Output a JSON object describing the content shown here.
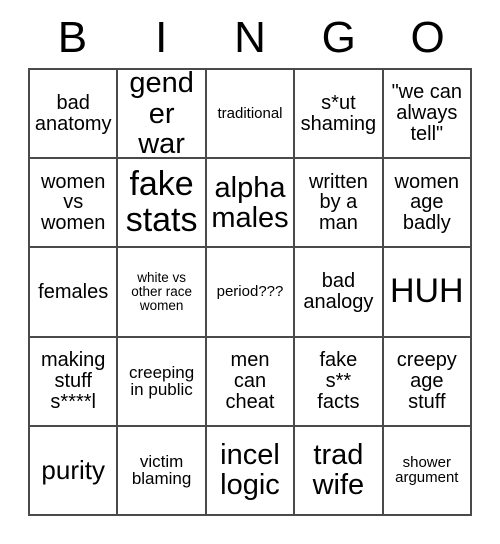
{
  "header": {
    "letters": [
      "B",
      "I",
      "N",
      "G",
      "O"
    ]
  },
  "grid": {
    "rows": 5,
    "columns": 5,
    "border_color": "#4a4a4a",
    "cell_background": "#ffffff",
    "text_color": "#000000",
    "cells": [
      {
        "text": "bad\nanatomy",
        "size": "md"
      },
      {
        "text": "gender\nwar",
        "size": "xl"
      },
      {
        "text": "traditional",
        "size": "xs"
      },
      {
        "text": "s*ut\nshaming",
        "size": "md"
      },
      {
        "text": "\"we can\nalways\ntell\"",
        "size": "md"
      },
      {
        "text": "women\nvs\nwomen",
        "size": "md"
      },
      {
        "text": "fake\nstats",
        "size": "xxl"
      },
      {
        "text": "alpha\nmales",
        "size": "xl"
      },
      {
        "text": "written\nby a\nman",
        "size": "md"
      },
      {
        "text": "women\nage\nbadly",
        "size": "md"
      },
      {
        "text": "females",
        "size": "md"
      },
      {
        "text": "white vs\nother race\nwomen",
        "size": "xxs"
      },
      {
        "text": "period???",
        "size": "xs"
      },
      {
        "text": "bad\nanalogy",
        "size": "md"
      },
      {
        "text": "HUH",
        "size": "xxl"
      },
      {
        "text": "making\nstuff\ns****l",
        "size": "md"
      },
      {
        "text": "creeping\nin public",
        "size": "sm"
      },
      {
        "text": "men\ncan\ncheat",
        "size": "md"
      },
      {
        "text": "fake\ns**\nfacts",
        "size": "md"
      },
      {
        "text": "creepy\nage\nstuff",
        "size": "md"
      },
      {
        "text": "purity",
        "size": "lg"
      },
      {
        "text": "victim\nblaming",
        "size": "sm"
      },
      {
        "text": "incel\nlogic",
        "size": "xl"
      },
      {
        "text": "trad\nwife",
        "size": "xl"
      },
      {
        "text": "shower\nargument",
        "size": "xs"
      }
    ]
  }
}
